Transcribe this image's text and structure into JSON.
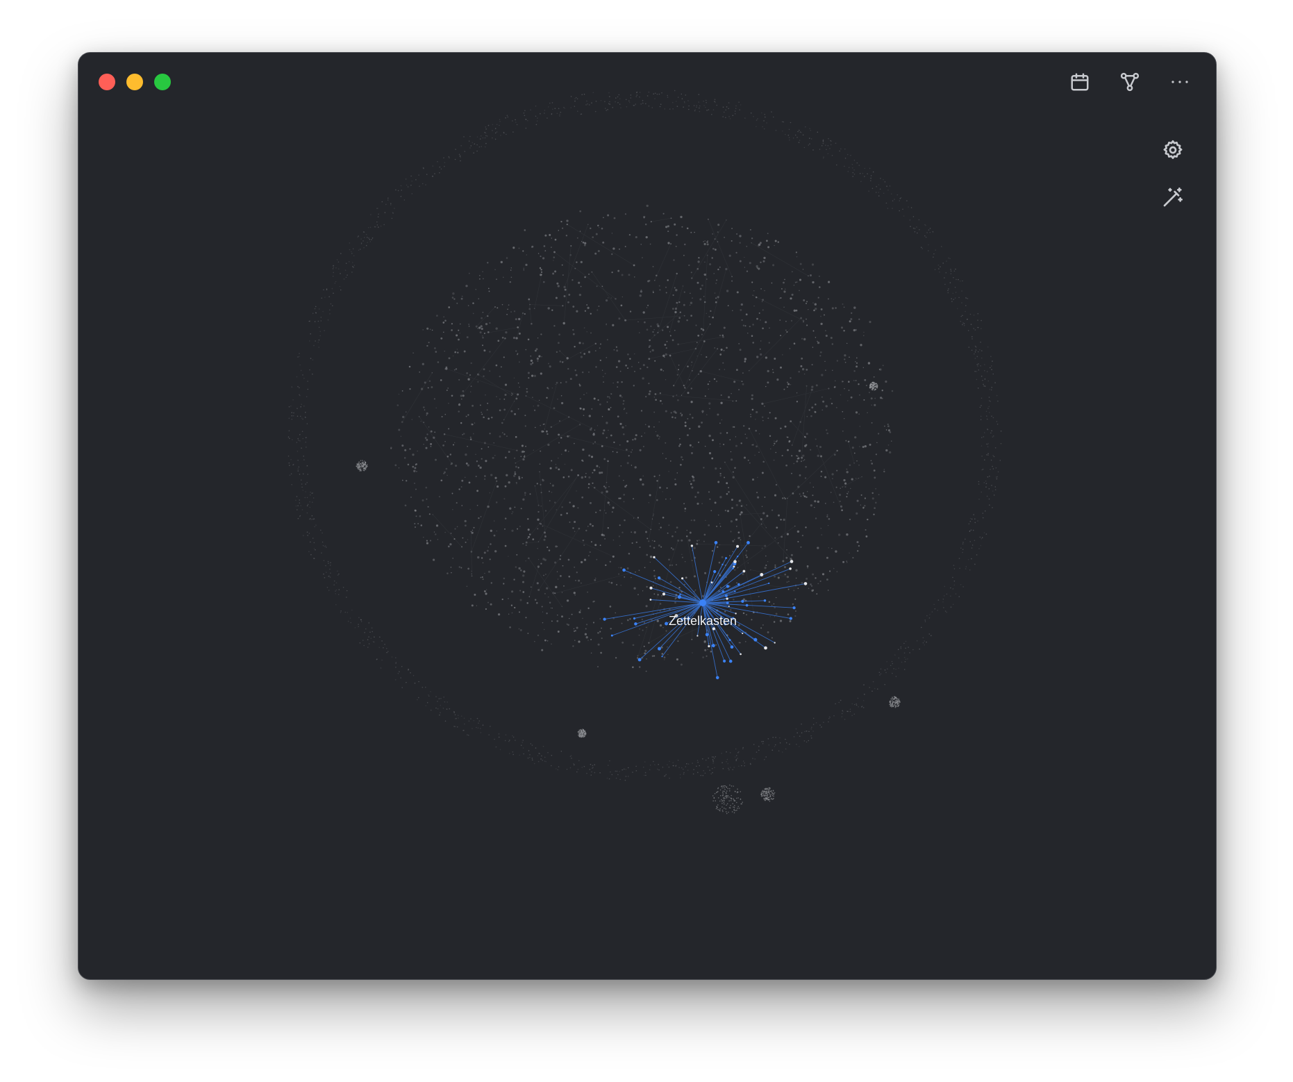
{
  "window": {
    "traffic_lights": {
      "close_color": "#ff5f57",
      "minimize_color": "#febc2e",
      "maximize_color": "#28c840"
    }
  },
  "toolbar": {
    "icons": [
      "calendar-icon",
      "graph-icon",
      "more-icon"
    ]
  },
  "graph_controls": {
    "icons": [
      "gear-icon",
      "magic-wand-icon"
    ]
  },
  "graph": {
    "focused_node_label": "Zettelkasten",
    "accent_color": "#3b82f6",
    "node_color": "#8a8c91",
    "background": "#24262b"
  }
}
